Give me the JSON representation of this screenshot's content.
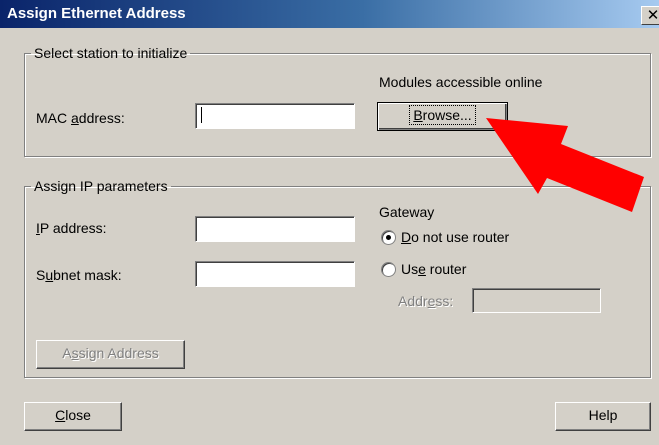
{
  "window": {
    "title": "Assign Ethernet Address",
    "close_glyph": "✕"
  },
  "station_group": {
    "legend": "Select station to initialize",
    "modules_label": "Modules accessible online",
    "mac_label_pre": "MAC ",
    "mac_label_u": "a",
    "mac_label_post": "ddress:",
    "mac_value": "",
    "browse_u": "B",
    "browse_post": "rowse..."
  },
  "ip_group": {
    "legend": "Assign IP parameters",
    "ip_label_u": "I",
    "ip_label_post": "P address:",
    "ip_value": "",
    "subnet_pre": "S",
    "subnet_u": "u",
    "subnet_post": "bnet mask:",
    "subnet_value": "",
    "gateway_label": "Gateway",
    "no_router_u": "D",
    "no_router_post": "o not use router",
    "no_router_checked": true,
    "use_router_pre": "Us",
    "use_router_u": "e",
    "use_router_post": " router",
    "use_router_checked": false,
    "address_pre": "Addr",
    "address_u": "e",
    "address_post": "ss:",
    "address_value": "",
    "assign_pre": "A",
    "assign_u": "s",
    "assign_post": "sign Address"
  },
  "footer": {
    "close_u": "C",
    "close_post": "lose",
    "help_label": "Help"
  },
  "colors": {
    "arrow": "#ff0000",
    "face": "#d4d0c8",
    "title_start": "#0a246a"
  },
  "icons": {
    "arrow": "red-arrow-annotation",
    "radio": "radio-button"
  }
}
